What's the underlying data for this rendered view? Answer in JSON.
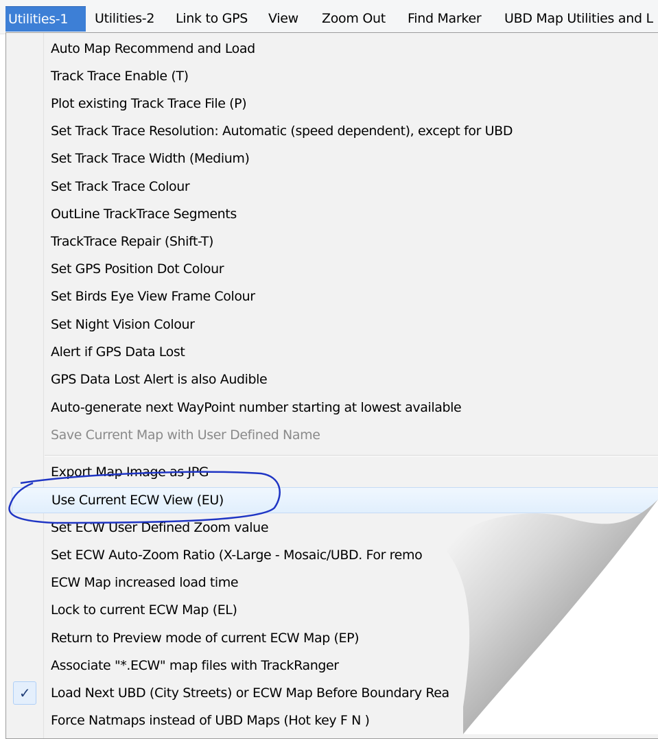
{
  "menubar": {
    "items": [
      {
        "label": "Utilities-1",
        "active": true
      },
      {
        "label": "Utilities-2"
      },
      {
        "label": "Link to GPS"
      },
      {
        "label": "View"
      },
      {
        "label": "Zoom Out"
      },
      {
        "label": "Find Marker"
      },
      {
        "label": "UBD Map Utilities and L"
      }
    ]
  },
  "menu": {
    "items": [
      {
        "label": "Auto Map Recommend and Load"
      },
      {
        "label": "Track Trace Enable (T)"
      },
      {
        "label": "Plot existing Track Trace File (P)"
      },
      {
        "label": "Set Track Trace Resolution:  Automatic (speed dependent), except for UBD"
      },
      {
        "label": "Set Track Trace Width   (Medium)"
      },
      {
        "label": "Set Track Trace  Colour"
      },
      {
        "label": "OutLine TrackTrace Segments"
      },
      {
        "label": "TrackTrace Repair (Shift-T)"
      },
      {
        "label": "Set GPS Position Dot Colour"
      },
      {
        "label": "Set Birds Eye View Frame Colour"
      },
      {
        "label": "Set Night Vision Colour"
      },
      {
        "label": "Alert if GPS Data Lost"
      },
      {
        "label": "GPS Data Lost Alert is also Audible"
      },
      {
        "label": "Auto-generate next WayPoint number starting at lowest available"
      },
      {
        "label": "Save Current Map with User Defined Name",
        "disabled": true
      },
      {
        "label": "Export Map Image as JPG"
      },
      {
        "label": "Use Current ECW View (EU)",
        "highlighted": true
      },
      {
        "label": "Set ECW User Defined Zoom value"
      },
      {
        "label": "Set ECW Auto-Zoom Ratio (X-Large - Mosaic/UBD. For remo"
      },
      {
        "label": "ECW Map increased load time"
      },
      {
        "label": "Lock to current ECW Map (EL)"
      },
      {
        "label": "Return to Preview mode of current ECW Map (EP)"
      },
      {
        "label": "Associate \"*.ECW\" map files with TrackRanger"
      },
      {
        "label": "Load Next UBD (City Streets) or ECW Map Before Boundary Rea",
        "checked": true
      },
      {
        "label": "Force Natmaps instead of UBD Maps (Hot key F N )"
      }
    ],
    "checkmark_glyph": "✓"
  },
  "colors": {
    "menubar_active": "#3d7fd6",
    "highlight_ellipse": "#1f35c4",
    "disabled_text": "#8a8a8a"
  },
  "icons": {
    "checkmark": "check-icon"
  }
}
